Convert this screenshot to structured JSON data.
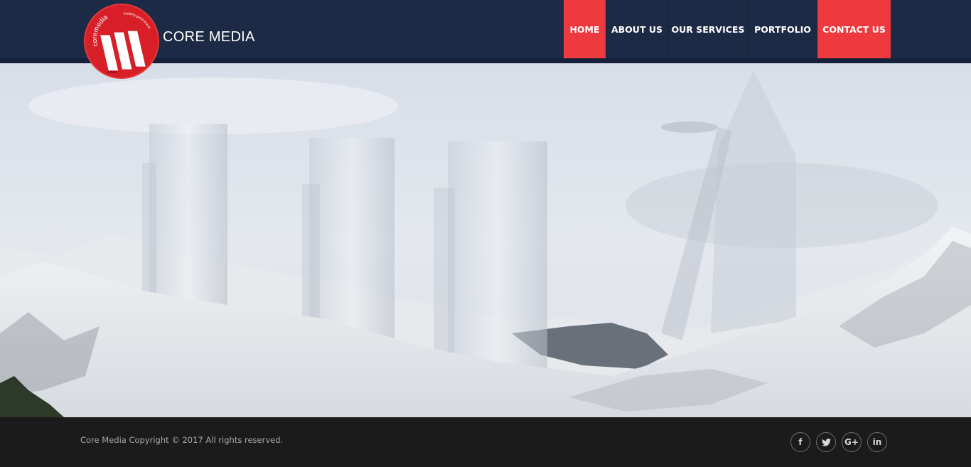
{
  "brand": {
    "name": "CORE MEDIA",
    "badge_text": "coremedia",
    "tagline": "building great brands"
  },
  "nav": {
    "items": [
      {
        "label": "HOME",
        "active": true
      },
      {
        "label": "ABOUT US",
        "active": false
      },
      {
        "label": "OUR SERVICES",
        "active": false
      },
      {
        "label": "PORTFOLIO",
        "active": false
      },
      {
        "label": "CONTACT US",
        "active": false,
        "highlight": true
      }
    ]
  },
  "hero": {
    "icon": "snowy-mountains-with-glass-towers-image"
  },
  "footer": {
    "copyright": "Core Media Copyright © 2017 All rights reserved.",
    "socials": [
      {
        "icon": "facebook-icon",
        "glyph": "f"
      },
      {
        "icon": "twitter-icon",
        "glyph": "t"
      },
      {
        "icon": "google-plus-icon",
        "glyph": "G+"
      },
      {
        "icon": "linkedin-icon",
        "glyph": "in"
      }
    ]
  },
  "colors": {
    "header_bg": "#1c2a45",
    "accent": "#ee3a3f",
    "footer_bg": "#1b1b1b",
    "logo_red": "#d81e27"
  }
}
